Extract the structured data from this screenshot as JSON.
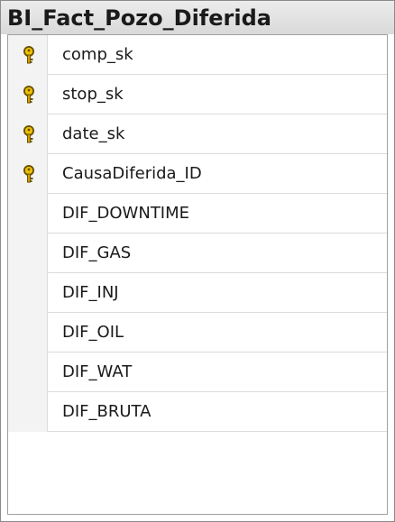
{
  "table": {
    "title": "BI_Fact_Pozo_Diferida",
    "columns": [
      {
        "name": "comp_sk",
        "primary_key": true,
        "icon": "key-icon"
      },
      {
        "name": "stop_sk",
        "primary_key": true,
        "icon": "key-icon"
      },
      {
        "name": "date_sk",
        "primary_key": true,
        "icon": "key-icon"
      },
      {
        "name": "CausaDiferida_ID",
        "primary_key": true,
        "icon": "key-icon"
      },
      {
        "name": "DIF_DOWNTIME",
        "primary_key": false
      },
      {
        "name": "DIF_GAS",
        "primary_key": false
      },
      {
        "name": "DIF_INJ",
        "primary_key": false
      },
      {
        "name": "DIF_OIL",
        "primary_key": false
      },
      {
        "name": "DIF_WAT",
        "primary_key": false
      },
      {
        "name": "DIF_BRUTA",
        "primary_key": false
      }
    ]
  },
  "colors": {
    "key_icon": "#d4a000",
    "title_bar": "#e3e3e3",
    "border": "#8a8a8a"
  }
}
